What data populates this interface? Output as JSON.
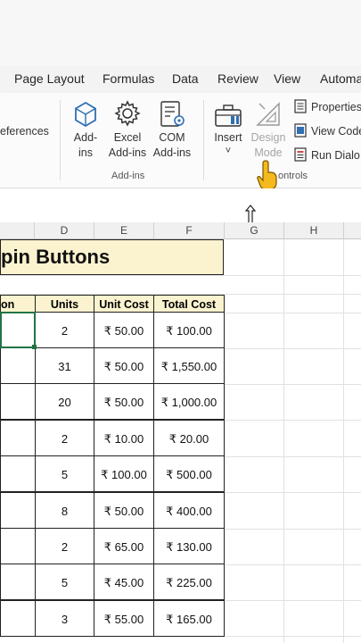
{
  "menu": {
    "tabs": [
      "Page Layout",
      "Formulas",
      "Data",
      "Review",
      "View",
      "Automa"
    ]
  },
  "ribbon": {
    "references_label": "eferences",
    "addins": {
      "addins_line1": "Add-",
      "addins_line2": "ins",
      "excel_line1": "Excel",
      "excel_line2": "Add-ins",
      "com_line1": "COM",
      "com_line2": "Add-ins",
      "group_label": "Add-ins"
    },
    "controls": {
      "insert_label": "Insert",
      "insert_caret": "˅",
      "design_line1": "Design",
      "design_line2": "Mode",
      "properties_label": "Properties",
      "view_code_label": "View Code",
      "run_dialog_label": "Run Dialo",
      "group_label": "ontrols"
    }
  },
  "columns": [
    "D",
    "E",
    "F",
    "G",
    "H"
  ],
  "sheet": {
    "title": "pin Buttons",
    "headers": [
      "on",
      "Units",
      "Unit Cost",
      "Total Cost"
    ],
    "rows": [
      {
        "units": "2",
        "unit_cost": "₹ 50.00",
        "total_cost": "₹ 100.00"
      },
      {
        "units": "31",
        "unit_cost": "₹ 50.00",
        "total_cost": "₹ 1,550.00"
      },
      {
        "units": "20",
        "unit_cost": "₹ 50.00",
        "total_cost": "₹ 1,000.00"
      },
      {
        "units": "2",
        "unit_cost": "₹ 10.00",
        "total_cost": "₹ 20.00"
      },
      {
        "units": "5",
        "unit_cost": "₹ 100.00",
        "total_cost": "₹ 500.00"
      },
      {
        "units": "8",
        "unit_cost": "₹ 50.00",
        "total_cost": "₹ 400.00"
      },
      {
        "units": "2",
        "unit_cost": "₹ 65.00",
        "total_cost": "₹ 130.00"
      },
      {
        "units": "5",
        "unit_cost": "₹ 45.00",
        "total_cost": "₹ 225.00"
      },
      {
        "units": "3",
        "unit_cost": "₹ 55.00",
        "total_cost": "₹ 165.00"
      }
    ]
  },
  "colors": {
    "title_fill": "#fbf3cf",
    "selection": "#217346",
    "icon_blue": "#2f6fb3"
  }
}
